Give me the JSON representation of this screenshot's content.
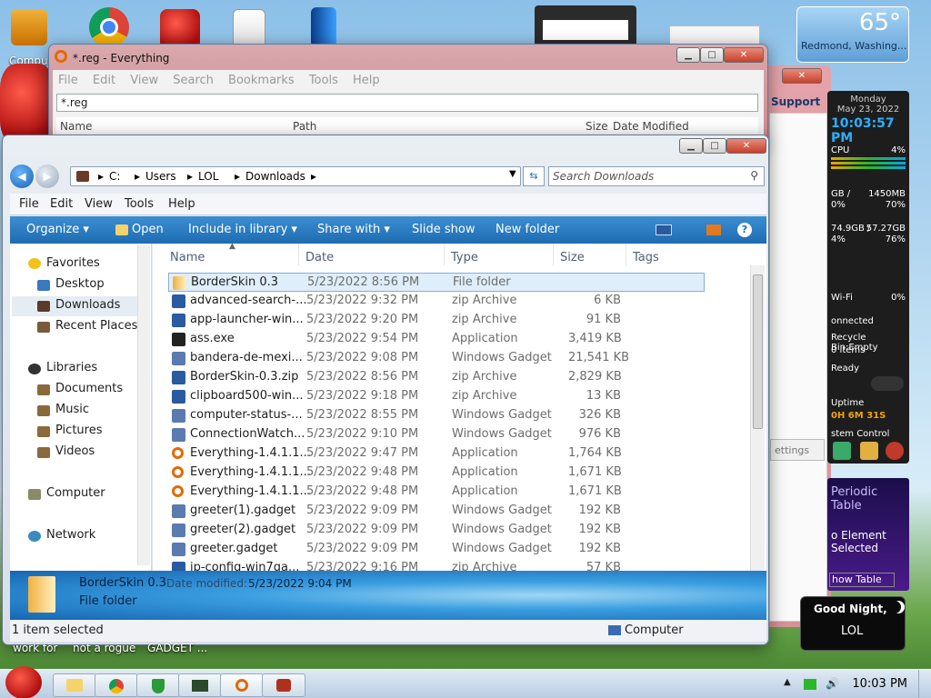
{
  "desktop": {
    "computer_label": "Compu",
    "bottom_text": [
      "work for",
      "not a rogue",
      "GADGET ..."
    ]
  },
  "weather": {
    "temp": "65°",
    "location": "Redmond, Washing..."
  },
  "sidebar": {
    "date_day": "Monday",
    "date": "May 23, 2022",
    "time": "10:03:57 PM",
    "cpu_label": "CPU",
    "cpu_pct": "4%",
    "ram_left": "GB /",
    "ram_right": "1450MB",
    "ram_pct_left": "0%",
    "ram_pct_right": "70%",
    "disk_left": "74.9GB /",
    "disk_right": "57.27GB",
    "disk_pct_left": "4%",
    "disk_pct_right": "76%",
    "wifi_label": "Wi-Fi",
    "wifi_pct": "0%",
    "connected": "onnected",
    "recycle": "Recycle Bin:Empty",
    "items": "0 items",
    "ready": "Ready",
    "uptime_label": "Uptime",
    "uptime": "0H 6M 31S",
    "system_control": "stem Control"
  },
  "periodic": {
    "title": "Periodic Table",
    "sub": "o Element Selected",
    "button": "how Table"
  },
  "night": {
    "greeting": "Good Night,",
    "name": "LOL"
  },
  "support_window": {
    "title": "Support",
    "settings": "ettings"
  },
  "everything": {
    "title": "*.reg - Everything",
    "menu": [
      "File",
      "Edit",
      "View",
      "Search",
      "Bookmarks",
      "Tools",
      "Help"
    ],
    "search_value": "*.reg",
    "columns": [
      "Name",
      "Path",
      "Size",
      "Date Modified"
    ]
  },
  "explorer": {
    "breadcrumb": [
      "C:",
      "Users",
      "LOL",
      "Downloads"
    ],
    "search_placeholder": "Search Downloads",
    "menu": [
      "File",
      "Edit",
      "View",
      "Tools",
      "Help"
    ],
    "commands": [
      "Organize ▾",
      "Open",
      "Include in library ▾",
      "Share with ▾",
      "Slide show",
      "New folder"
    ],
    "nav": {
      "favorites": "Favorites",
      "desktop": "Desktop",
      "downloads": "Downloads",
      "recent": "Recent Places",
      "libraries": "Libraries",
      "documents": "Documents",
      "music": "Music",
      "pictures": "Pictures",
      "videos": "Videos",
      "computer": "Computer",
      "network": "Network"
    },
    "columns": [
      "Name",
      "Date",
      "Type",
      "Size",
      "Tags"
    ],
    "files": [
      {
        "name": "BorderSkin 0.3",
        "date": "5/23/2022 8:56 PM",
        "type": "File folder",
        "size": "",
        "icon": "folder-icon"
      },
      {
        "name": "advanced-search-...",
        "date": "5/23/2022 9:32 PM",
        "type": "zip Archive",
        "size": "6 KB",
        "icon": "zip-icon"
      },
      {
        "name": "app-launcher-win...",
        "date": "5/23/2022 9:20 PM",
        "type": "zip Archive",
        "size": "91 KB",
        "icon": "zip-icon"
      },
      {
        "name": "ass.exe",
        "date": "5/23/2022 9:54 PM",
        "type": "Application",
        "size": "3,419 KB",
        "icon": "exe-icon"
      },
      {
        "name": "bandera-de-mexi...",
        "date": "5/23/2022 9:08 PM",
        "type": "Windows Gadget",
        "size": "21,541 KB",
        "icon": "gadget-icon"
      },
      {
        "name": "BorderSkin-0.3.zip",
        "date": "5/23/2022 8:56 PM",
        "type": "zip Archive",
        "size": "2,829 KB",
        "icon": "zip-icon"
      },
      {
        "name": "clipboard500-win...",
        "date": "5/23/2022 9:18 PM",
        "type": "zip Archive",
        "size": "13 KB",
        "icon": "zip-icon"
      },
      {
        "name": "computer-status-...",
        "date": "5/23/2022 8:55 PM",
        "type": "Windows Gadget",
        "size": "326 KB",
        "icon": "gadget-icon"
      },
      {
        "name": "ConnectionWatch...",
        "date": "5/23/2022 9:10 PM",
        "type": "Windows Gadget",
        "size": "976 KB",
        "icon": "gadget-icon"
      },
      {
        "name": "Everything-1.4.1.1...",
        "date": "5/23/2022 9:47 PM",
        "type": "Application",
        "size": "1,764 KB",
        "icon": "search-app-icon"
      },
      {
        "name": "Everything-1.4.1.1...",
        "date": "5/23/2022 9:48 PM",
        "type": "Application",
        "size": "1,671 KB",
        "icon": "search-app-icon"
      },
      {
        "name": "Everything-1.4.1.1...",
        "date": "5/23/2022 9:48 PM",
        "type": "Application",
        "size": "1,671 KB",
        "icon": "search-app-icon"
      },
      {
        "name": "greeter(1).gadget",
        "date": "5/23/2022 9:09 PM",
        "type": "Windows Gadget",
        "size": "192 KB",
        "icon": "gadget-icon"
      },
      {
        "name": "greeter(2).gadget",
        "date": "5/23/2022 9:09 PM",
        "type": "Windows Gadget",
        "size": "192 KB",
        "icon": "gadget-icon"
      },
      {
        "name": "greeter.gadget",
        "date": "5/23/2022 9:09 PM",
        "type": "Windows Gadget",
        "size": "192 KB",
        "icon": "gadget-icon"
      },
      {
        "name": "ip-config-win7ga...",
        "date": "5/23/2022 9:16 PM",
        "type": "zip Archive",
        "size": "57 KB",
        "icon": "zip-icon"
      }
    ],
    "details": {
      "name": "BorderSkin 0.3",
      "modified_label": "Date modified:",
      "modified": "5/23/2022 9:04 PM",
      "type": "File folder"
    },
    "status": {
      "selected": "1 item selected",
      "location": "Computer"
    }
  },
  "taskbar": {
    "time": "10:03 PM"
  },
  "colors": {
    "selection": "#dfeefb",
    "command_bar": "#1e6cb3",
    "taskbar": "#c9d9e9"
  }
}
